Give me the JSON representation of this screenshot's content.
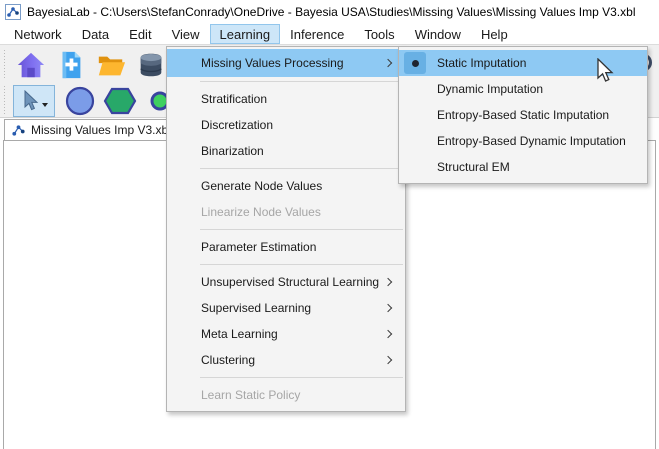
{
  "window": {
    "title": "BayesiaLab - C:\\Users\\StefanConrady\\OneDrive - Bayesia USA\\Studies\\Missing Values\\Missing Values Imp V3.xbl"
  },
  "menu_bar": {
    "items": [
      "Network",
      "Data",
      "Edit",
      "View",
      "Learning",
      "Inference",
      "Tools",
      "Window",
      "Help"
    ],
    "active_item": "Learning"
  },
  "toolbar": {
    "icons_row1": [
      "home-icon",
      "new-network-icon",
      "open-folder-icon",
      "database-icon",
      "database-save-icon"
    ],
    "icons_row2": [
      "selection-tool-icon",
      "node-tool-icon",
      "decision-node-tool-icon",
      "constraint-node-tool-icon",
      "arc-tool-icon"
    ],
    "search": "search-icon",
    "selected_tool": "selection-tool-icon"
  },
  "tab_bar": {
    "active_tab_label": "Missing Values Imp V3.xbl *"
  },
  "learning_menu": {
    "highlighted_item": "Missing Values Processing",
    "items": [
      {
        "label": "Missing Values Processing",
        "has_submenu": true,
        "state": "highlighted"
      },
      {
        "label": "Stratification"
      },
      {
        "label": "Discretization"
      },
      {
        "label": "Binarization"
      },
      {
        "label": "Generate Node Values"
      },
      {
        "label": "Linearize Node Values",
        "state": "disabled"
      },
      {
        "label": "Parameter Estimation"
      },
      {
        "label": "Unsupervised Structural Learning",
        "has_submenu": true
      },
      {
        "label": "Supervised Learning",
        "has_submenu": true
      },
      {
        "label": "Meta Learning",
        "has_submenu": true
      },
      {
        "label": "Clustering",
        "has_submenu": true
      },
      {
        "label": "Learn Static Policy",
        "state": "disabled"
      }
    ]
  },
  "missing_values_submenu": {
    "highlighted_item": "Static Imputation",
    "items": [
      {
        "label": "Static Imputation",
        "state": "highlighted",
        "radio_selected": true
      },
      {
        "label": "Dynamic Imputation"
      },
      {
        "label": "Entropy-Based Static Imputation"
      },
      {
        "label": "Entropy-Based Dynamic Imputation"
      },
      {
        "label": "Structural EM"
      }
    ]
  },
  "colors": {
    "menu_highlight": "#8ec9f3",
    "menubar_item_highlight": "#cde6f8",
    "radio_badge_bg": "#68b0e4",
    "menu_panel_bg": "#f4f4f4",
    "disabled_text": "#a6a6a6",
    "toolbar_bg": "#f0f0f0"
  }
}
